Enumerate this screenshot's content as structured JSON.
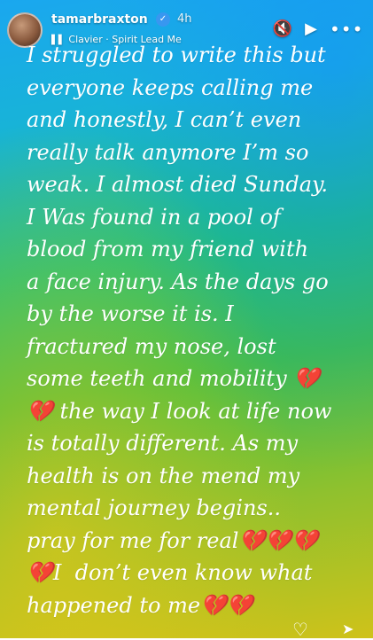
{
  "header": {
    "username": "tamarbraxton",
    "time": "4h",
    "music": "Clavier · Spirit Lead Me"
  },
  "icons": {
    "verified": "verified-badge-icon",
    "mute": "speaker-mute-icon",
    "play": "play-icon",
    "more": "more-icon",
    "like": "heart-icon",
    "share": "send-icon"
  },
  "story": {
    "text": "I struggled to write this but\neveryone keeps calling me\nand honestly, I can’t even\nreally talk anymore I’m so\nweak. I almost died Sunday.\nI Was found in a pool of\nblood from my friend with\na face injury. As the days go\nby the worse it is. I\nfractured my nose, lost\nsome teeth and mobility 💔\n💔 the way I look at life now\nis totally different. As my\nhealth is on the mend my\nmental journey begins..\npray for me for real💔💔💔\n💔I  don’t even know what\nhappened to me💔💔"
  },
  "colors": {
    "gradient_top": "#1aa7ef",
    "gradient_mid": "#1ec07a",
    "gradient_bottom": "#cfc21a",
    "verified_badge": "#3897f0"
  }
}
